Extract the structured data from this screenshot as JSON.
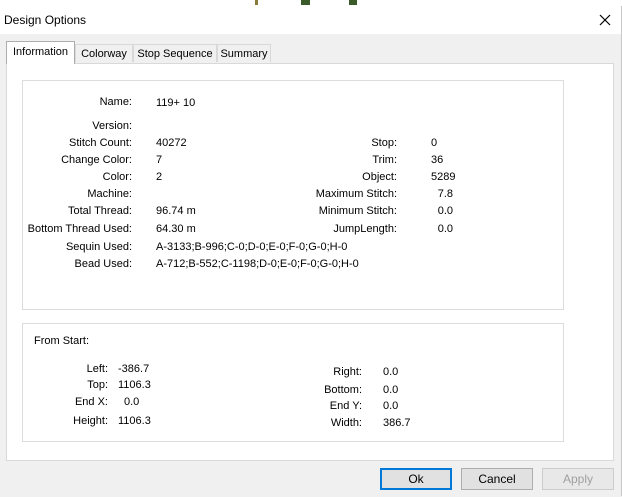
{
  "window": {
    "title": "Design Options"
  },
  "tabs": [
    {
      "label": "Information",
      "active": true
    },
    {
      "label": "Colorway"
    },
    {
      "label": "Stop Sequence"
    },
    {
      "label": "Summary"
    }
  ],
  "info": {
    "name": {
      "label": "Name:",
      "value": "119+ 10"
    },
    "version": {
      "label": "Version:",
      "value": ""
    },
    "stitch_count": {
      "label": "Stitch Count:",
      "value": "40272"
    },
    "change_color": {
      "label": "Change Color:",
      "value": "7"
    },
    "color": {
      "label": "Color:",
      "value": "2"
    },
    "machine": {
      "label": "Machine:",
      "value": ""
    },
    "total_thread": {
      "label": "Total Thread:",
      "value": "96.74 m"
    },
    "bottom_thread": {
      "label": "Bottom Thread Used:",
      "value": "64.30 m"
    },
    "sequin_used": {
      "label": "Sequin Used:",
      "value": "A-3133;B-996;C-0;D-0;E-0;F-0;G-0;H-0"
    },
    "bead_used": {
      "label": "Bead Used:",
      "value": "A-712;B-552;C-1198;D-0;E-0;F-0;G-0;H-0"
    },
    "stop": {
      "label": "Stop:",
      "value": "0"
    },
    "trim": {
      "label": "Trim:",
      "value": "36"
    },
    "object": {
      "label": "Object:",
      "value": "5289"
    },
    "max_stitch": {
      "label": "Maximum Stitch:",
      "value": "7.8"
    },
    "min_stitch": {
      "label": "Minimum Stitch:",
      "value": "0.0"
    },
    "jump_length": {
      "label": "JumpLength:",
      "value": "0.0"
    }
  },
  "from_start": {
    "title": "From Start:",
    "left": {
      "label": "Left:",
      "value": "-386.7"
    },
    "top": {
      "label": "Top:",
      "value": "1106.3"
    },
    "end_x": {
      "label": "End X:",
      "value": "0.0"
    },
    "height": {
      "label": "Height:",
      "value": "1106.3"
    },
    "right": {
      "label": "Right:",
      "value": "0.0"
    },
    "bottom": {
      "label": "Bottom:",
      "value": "0.0"
    },
    "end_y": {
      "label": "End Y:",
      "value": "0.0"
    },
    "width": {
      "label": "Width:",
      "value": "386.7"
    }
  },
  "buttons": {
    "ok": "Ok",
    "cancel": "Cancel",
    "apply": "Apply"
  },
  "colors": {
    "accent": "#0078d7",
    "panel": "#ffffff",
    "dialog": "#f0f0f0"
  },
  "icons": {
    "close": "close-icon"
  }
}
